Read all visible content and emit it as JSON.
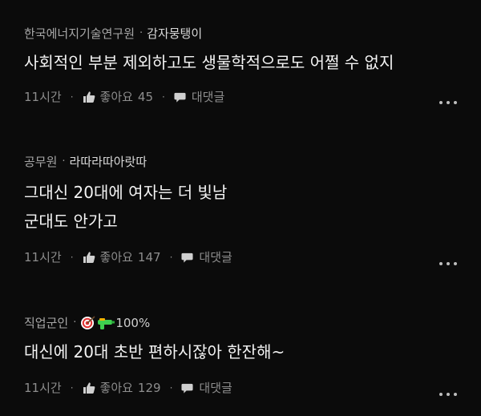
{
  "comments": [
    {
      "org": "한국에너지기술연구원",
      "nickname": "감자뭉탱이",
      "lines": [
        "사회적인 부분 제외하고도 생물학적으로도 어쩔 수 없지"
      ],
      "time": "11시간",
      "like_label": "좋아요",
      "like_count": "45",
      "reply_label": "대댓글"
    },
    {
      "org": "공무원",
      "nickname": "라따라따아랏따",
      "lines": [
        "그대신 20대에 여자는 더 빛남",
        "군대도 안가고"
      ],
      "time": "11시간",
      "like_label": "좋아요",
      "like_count": "147",
      "reply_label": "대댓글"
    },
    {
      "org": "직업군인",
      "nickname_badge": "100%",
      "lines": [
        "대신에 20대 초반 편하시잖아 한잔해~"
      ],
      "time": "11시간",
      "like_label": "좋아요",
      "like_count": "129",
      "reply_label": "대댓글"
    }
  ],
  "separator": "·",
  "icons": {
    "like": "thumbs-up-icon",
    "reply": "speech-bubble-icon",
    "more": "more-dots-icon",
    "target": "target-icon",
    "gun": "water-gun-icon"
  },
  "colors": {
    "background": "#0b0b0b",
    "text": "#f4f4f4",
    "muted": "#8d8d8d"
  }
}
